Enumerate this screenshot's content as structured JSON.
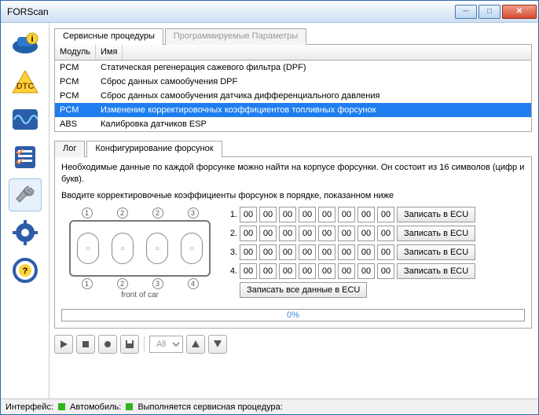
{
  "window": {
    "title": "FORScan"
  },
  "sidebar": {
    "items": [
      {
        "name": "vehicle-icon"
      },
      {
        "name": "dtc-icon"
      },
      {
        "name": "wave-icon"
      },
      {
        "name": "list-icon"
      },
      {
        "name": "wrench-icon",
        "selected": true
      },
      {
        "name": "gear-icon"
      },
      {
        "name": "steering-icon"
      }
    ]
  },
  "tabs": {
    "service": "Сервисные процедуры",
    "params": "Программируемые Параметры"
  },
  "table": {
    "headers": {
      "module": "Модуль",
      "name": "Имя"
    },
    "rows": [
      {
        "mod": "PCM",
        "name": "Статическая регенерация сажевого фильтра (DPF)"
      },
      {
        "mod": "PCM",
        "name": "Сброс данных самообучения DPF"
      },
      {
        "mod": "PCM",
        "name": "Сброс данных самообучения датчика дифференциального давления"
      },
      {
        "mod": "PCM",
        "name": "Изменение корректировочных коэффициентов топливных форсунок",
        "selected": true
      },
      {
        "mod": "ABS",
        "name": "Калибровка датчиков ESP"
      }
    ]
  },
  "subtabs": {
    "log": "Лог",
    "config": "Конфигурирование форсунок"
  },
  "panel": {
    "desc1": "Необходимые данные по каждой форсунке можно найти на корпусе форсунки. Он состоит из 16 символов (цифр и букв).",
    "desc2": "Вводите корректировочные коэффициенты форсунок в порядке, показанном ниже",
    "front": "front of car",
    "topnums": [
      "1",
      "2",
      "2",
      "3"
    ],
    "botnums": [
      "1",
      "2",
      "3",
      "4"
    ],
    "rows": [
      {
        "n": "1.",
        "v": [
          "00",
          "00",
          "00",
          "00",
          "00",
          "00",
          "00",
          "00"
        ]
      },
      {
        "n": "2.",
        "v": [
          "00",
          "00",
          "00",
          "00",
          "00",
          "00",
          "00",
          "00"
        ]
      },
      {
        "n": "3.",
        "v": [
          "00",
          "00",
          "00",
          "00",
          "00",
          "00",
          "00",
          "00"
        ]
      },
      {
        "n": "4.",
        "v": [
          "00",
          "00",
          "00",
          "00",
          "00",
          "00",
          "00",
          "00"
        ]
      }
    ],
    "write": "Записать в ECU",
    "writeAll": "Записать все данные в ECU",
    "progress": "0%"
  },
  "toolbar": {
    "all": "All"
  },
  "status": {
    "iface": "Интерфейс:",
    "car": "Автомобиль:",
    "msg": "Выполняется сервисная процедура:"
  }
}
